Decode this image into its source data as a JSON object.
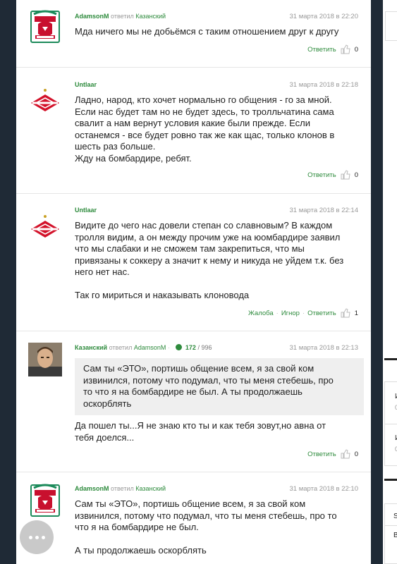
{
  "actions": {
    "reply": "Ответить",
    "complain": "Жалоба",
    "ignore": "Игнор",
    "replied_word": "ответил"
  },
  "colors": {
    "accent": "#2e8b3d",
    "background": "#1f2a36"
  },
  "comments": [
    {
      "author": "AdamsonM",
      "reply_to": "Казанский",
      "date": "31 марта 2018 в 22:20",
      "text": "Мда ничего мы не добьёмся с таким отношением друг к другу",
      "likes": "0",
      "avatar": "liverpool-crest"
    },
    {
      "author": "Untlaar",
      "date": "31 марта 2018 в 22:18",
      "lines": [
        "Ладно, народ, кто хочет нормально го общения - го за мной.",
        "Если нас будет там но не будет здесь, то тролльчатина сама",
        "свалит а нам вернут условия какие были прежде. Если",
        "останемся - все будет ровно так же как щас, только клонов в",
        "шесть раз больше.",
        "Жду на бомбардире, ребят."
      ],
      "likes": "0",
      "avatar": "spartak-logo"
    },
    {
      "author": "Untlaar",
      "date": "31 марта 2018 в 22:14",
      "lines": [
        "Видите до чего нас довели степан со славновым? В каждом",
        "тролля видим, а он между прочим уже на юомбардире заявил",
        "что мы слабаки и не сможем там закрепиться, что мы",
        "привязаны к соккеру а значит к нему и никуда не уйдем т.к. без",
        "него нет нас."
      ],
      "text2": "Так го мириться и наказывать клоновода",
      "likes": "1",
      "avatar": "spartak-logo"
    },
    {
      "author": "Казанский",
      "reply_to": "AdamsonM",
      "rating": "172",
      "rating_max": "/ 996",
      "date": "31 марта 2018 в 22:13",
      "quote_lines": [
        "Сам ты «ЭТО», портишь общение всем, я за свой ком",
        "извинился, потому что подумал, что ты меня стебешь, про",
        "то что я на бомбардире не был. А ты продолжаешь",
        "оскорблять"
      ],
      "lines": [
        "Да пошел ты...Я не знаю кто ты и как тебя зовут,но авна от",
        "тебя доелся..."
      ],
      "likes": "0",
      "avatar": "user-photo"
    },
    {
      "author": "AdamsonM",
      "reply_to": "Казанский",
      "date": "31 марта 2018 в 22:10",
      "lines": [
        "Сам ты «ЭТО», портишь общение всем, я за свой ком",
        "извинился, потому что подумал, что ты меня стебешь, про то",
        "что я на бомбардире не был."
      ],
      "text2": "А ты продолжаешь оскорблять",
      "avatar": "liverpool-crest"
    }
  ],
  "sidebar": {
    "snippet1": "И",
    "snippet2": "0",
    "snippet3": "И",
    "snippet4": "0",
    "snippet5": "S",
    "snippet6": "B"
  }
}
